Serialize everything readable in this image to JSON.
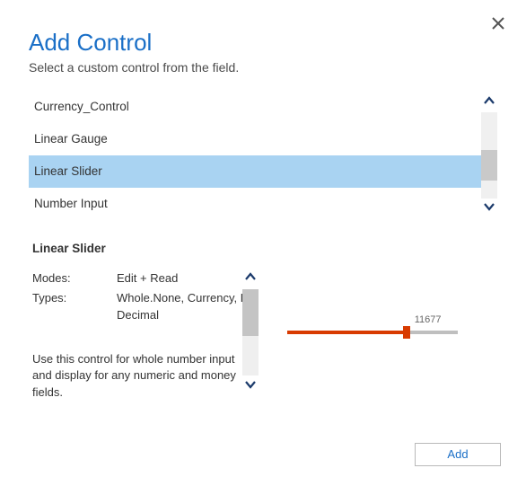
{
  "header": {
    "title": "Add Control",
    "subtitle": "Select a custom control from the field."
  },
  "list": {
    "items": [
      {
        "label": "Currency_Control"
      },
      {
        "label": "Linear Gauge"
      },
      {
        "label": "Linear Slider",
        "selected": true
      },
      {
        "label": "Number Input"
      }
    ]
  },
  "details": {
    "title": "Linear Slider",
    "modes_label": "Modes:",
    "modes_value": "Edit + Read",
    "types_label": "Types:",
    "types_value": "Whole.None, Currency, FP, Decimal",
    "description": "Use this control for whole number input and display for any numeric and money fields.",
    "preview_value": "11677"
  },
  "footer": {
    "add_label": "Add"
  },
  "icons": {
    "close": "close-icon"
  }
}
